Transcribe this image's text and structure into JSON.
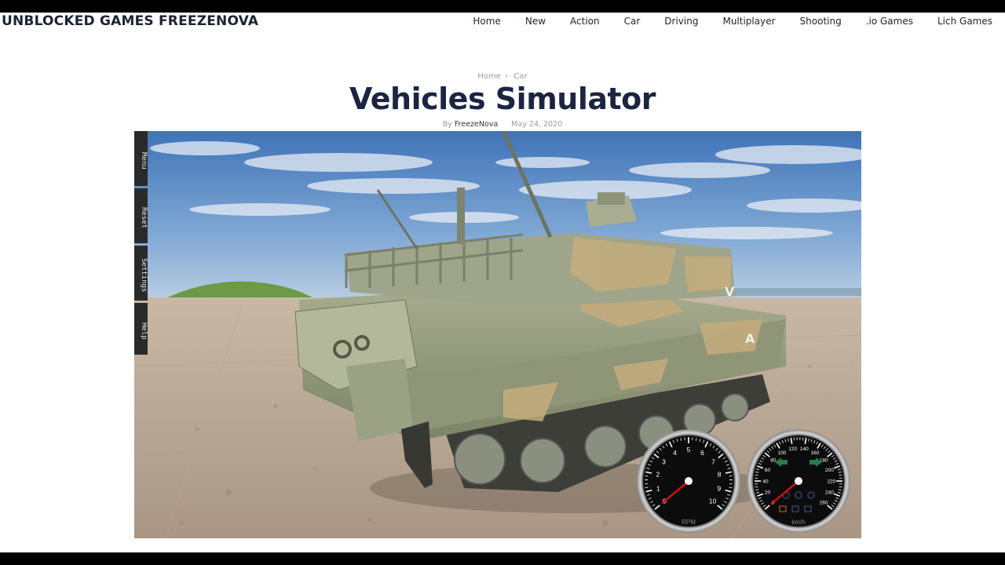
{
  "site": {
    "title": "UNBLOCKED GAMES FREEZENOVA"
  },
  "nav": [
    "Home",
    "New",
    "Action",
    "Car",
    "Driving",
    "Multiplayer",
    "Shooting",
    ".io Games",
    "Lich Games"
  ],
  "breadcrumb": {
    "home": "Home",
    "separator": "›",
    "category": "Car"
  },
  "article": {
    "title": "Vehicles Simulator",
    "by": "By",
    "author": "FreezeNova",
    "date": "May 24, 2020"
  },
  "game_menu": [
    "Menu",
    "Reset",
    "Settings",
    "Help"
  ],
  "tank_markings": [
    "V",
    "A"
  ],
  "rpm_gauge": {
    "unit": "RPM",
    "labels": [
      "0",
      "1",
      "2",
      "3",
      "4",
      "5",
      "6",
      "7",
      "8",
      "9",
      "10"
    ],
    "needle_value": 0
  },
  "speed_gauge": {
    "unit": "km/h",
    "labels": [
      "0",
      "20",
      "40",
      "60",
      "80",
      "100",
      "120",
      "140",
      "160",
      "180",
      "200",
      "220",
      "240",
      "260"
    ],
    "needle_value": 0
  },
  "colors": {
    "accent_dark": "#1b2440",
    "gauge_face": "#0c0c0c",
    "needle": "#d01010",
    "indicator_green": "#2a7a4a"
  }
}
